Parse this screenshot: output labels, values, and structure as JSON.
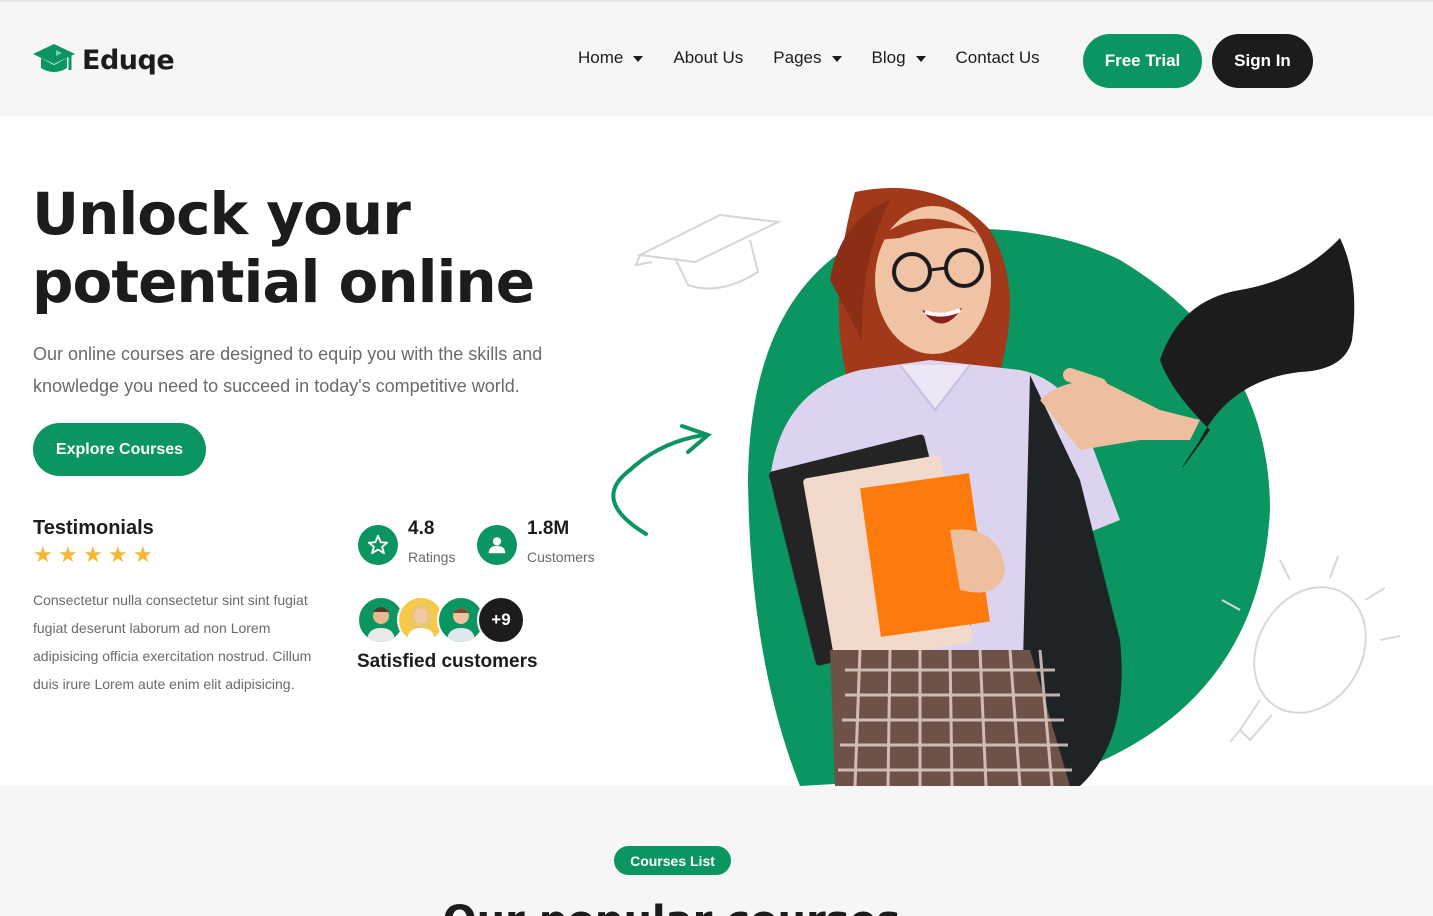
{
  "brand": {
    "name": "Eduqe",
    "accent": "#0b9560",
    "dark": "#1c1c1c"
  },
  "nav": {
    "items": [
      {
        "label": "Home",
        "dropdown": true
      },
      {
        "label": "About Us",
        "dropdown": false
      },
      {
        "label": "Pages",
        "dropdown": true
      },
      {
        "label": "Blog",
        "dropdown": true
      },
      {
        "label": "Contact Us",
        "dropdown": false
      }
    ],
    "trial_label": "Free Trial",
    "signin_label": "Sign In"
  },
  "hero": {
    "title_line1": "Unlock your",
    "title_line2": "potential online",
    "description": "Our online courses are designed to equip you with the skills and knowledge you need to succeed in today's competitive world.",
    "cta_label": "Explore Courses"
  },
  "testimonials": {
    "title": "Testimonials",
    "stars": 5,
    "text": "Consectetur nulla consectetur sint sint fugiat fugiat deserunt laborum ad non Lorem adipisicing officia exercitation nostrud. Cillum duis irure Lorem aute enim elit adipisicing."
  },
  "stats": {
    "ratings": {
      "value": "4.8",
      "label": "Ratings",
      "icon": "star-icon"
    },
    "customers": {
      "value": "1.8M",
      "label": "Customers",
      "icon": "user-icon"
    }
  },
  "satisfied": {
    "more": "+9",
    "label": "Satisfied customers"
  },
  "courses": {
    "badge": "Courses List",
    "title": "Our popular courses"
  }
}
